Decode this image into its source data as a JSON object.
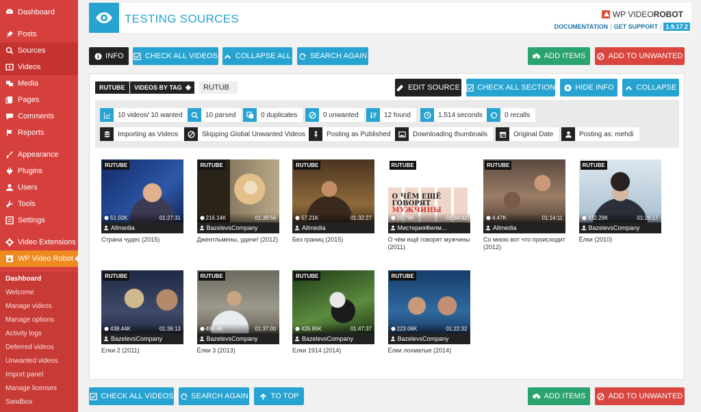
{
  "sidebar": {
    "menu": [
      {
        "label": "Dashboard",
        "icon": "dashboard-icon"
      },
      {
        "label": "Posts",
        "icon": "pin-icon"
      },
      {
        "label": "Sources",
        "icon": "search-icon"
      },
      {
        "label": "Videos",
        "icon": "video-icon"
      },
      {
        "label": "Media",
        "icon": "media-icon"
      },
      {
        "label": "Pages",
        "icon": "pages-icon"
      },
      {
        "label": "Comments",
        "icon": "comments-icon"
      },
      {
        "label": "Reports",
        "icon": "flag-icon"
      },
      {
        "label": "Appearance",
        "icon": "brush-icon"
      },
      {
        "label": "Plugins",
        "icon": "plugin-icon"
      },
      {
        "label": "Users",
        "icon": "user-icon"
      },
      {
        "label": "Tools",
        "icon": "wrench-icon"
      },
      {
        "label": "Settings",
        "icon": "settings-icon"
      },
      {
        "label": "Video Extensions",
        "icon": "gear-icon"
      },
      {
        "label": "WP Video Robot",
        "icon": "robot-icon"
      }
    ],
    "submenu": [
      "Dashboard",
      "Welcome",
      "Manage videos",
      "Manage options",
      "Activity logs",
      "Deferred videos",
      "Unwanted videos",
      "Import panel",
      "Manage licenses",
      "Sandbox"
    ]
  },
  "header": {
    "title": "TESTING SOURCES",
    "brand_prefix": "WP VIDEO ",
    "brand_strong": "ROBOT",
    "documentation": "DOCUMENTATION",
    "get_support": "GET SUPPORT",
    "version": "1.9.17.2"
  },
  "toolbar_top": {
    "info": "INFO",
    "check_all": "CHECK ALL VIDEOS",
    "collapse_all": "COLLAPSE ALL",
    "search_again": "SEARCH AGAIN",
    "add_items": "ADD ITEMS",
    "add_unwanted": "ADD TO UNWANTED"
  },
  "source": {
    "service": "RUTUBE",
    "type": "VIDEOS BY TAG",
    "query": "RUTUB",
    "edit_source": "EDIT SOURCE",
    "check_section": "CHECK ALL SECTION",
    "hide_info": "HIDE INFO",
    "collapse": "COLLAPSE"
  },
  "stats": [
    "10 videos/ 10 wanted",
    "10 parsed",
    "0 duplicates",
    "0 unwanted",
    "12 found",
    "1.514 seconds",
    "0 recalls"
  ],
  "options": [
    "Importing as Videos",
    "Skipping Global Unwanted Videos",
    "Posting as Published",
    "Downloading thumbnails",
    "Original Date",
    "Posting as: mehdi"
  ],
  "videos": [
    {
      "badge": "RUTUBE",
      "views": "51.02K",
      "duration": "01:27:31",
      "author": "Allmedia",
      "title": "Страна чудес (2015)"
    },
    {
      "badge": "RUTUBE",
      "views": "216.14K",
      "duration": "01:39:56",
      "author": "BazelevsCompany",
      "title": "Джентльмены, удачи! (2012)"
    },
    {
      "badge": "RUTUBE",
      "views": "57.21K",
      "duration": "01:32:27",
      "author": "Allmedia",
      "title": "Без границ (2015)"
    },
    {
      "badge": "RUTUBE",
      "views": "25.79K",
      "duration": "01:34:32",
      "author": "МистерияФилм...",
      "title": "О чём ещё говорят мужчины (2011)"
    },
    {
      "badge": "RUTUBE",
      "views": "4.47K",
      "duration": "01:14:11",
      "author": "Allmedia",
      "title": "Со мною вот что происходит (2012)"
    },
    {
      "badge": "RUTUBE",
      "views": "332.29K",
      "duration": "01:26:17",
      "author": "BazelevsCompany",
      "title": "Ёлки (2010)"
    },
    {
      "badge": "RUTUBE",
      "views": "438.44K",
      "duration": "01:36:13",
      "author": "BazelevsCompany",
      "title": "Елки 2 (2011)"
    },
    {
      "badge": "RUTUBE",
      "views": "496.6K",
      "duration": "01:37:00",
      "author": "BazelevsCompany",
      "title": "Ёлки 3 (2013)"
    },
    {
      "badge": "RUTUBE",
      "views": "426.85K",
      "duration": "01:47:37",
      "author": "BazelevsCompany",
      "title": "Елки 1914 (2014)"
    },
    {
      "badge": "RUTUBE",
      "views": "223.06K",
      "duration": "01:22:32",
      "author": "BazelevsCompany",
      "title": "Ёлки лохматые (2014)"
    }
  ],
  "poster_text": {
    "line1": "О ЧЁМ ЕЩЁ ГОВОРЯТ",
    "line2": "МУЖЧИНЫ"
  },
  "toolbar_bottom": {
    "check_all": "CHECK ALL VIDEOS",
    "search_again": "SEARCH AGAIN",
    "to_top": "TO TOP",
    "add_items": "ADD ITEMS",
    "add_unwanted": "ADD TO UNWANTED"
  },
  "colors": {
    "sidebar": "#d5403d",
    "accent": "#27a3d1",
    "active": "#ee8a1e",
    "green": "#2aa36f",
    "red": "#d9463f"
  }
}
